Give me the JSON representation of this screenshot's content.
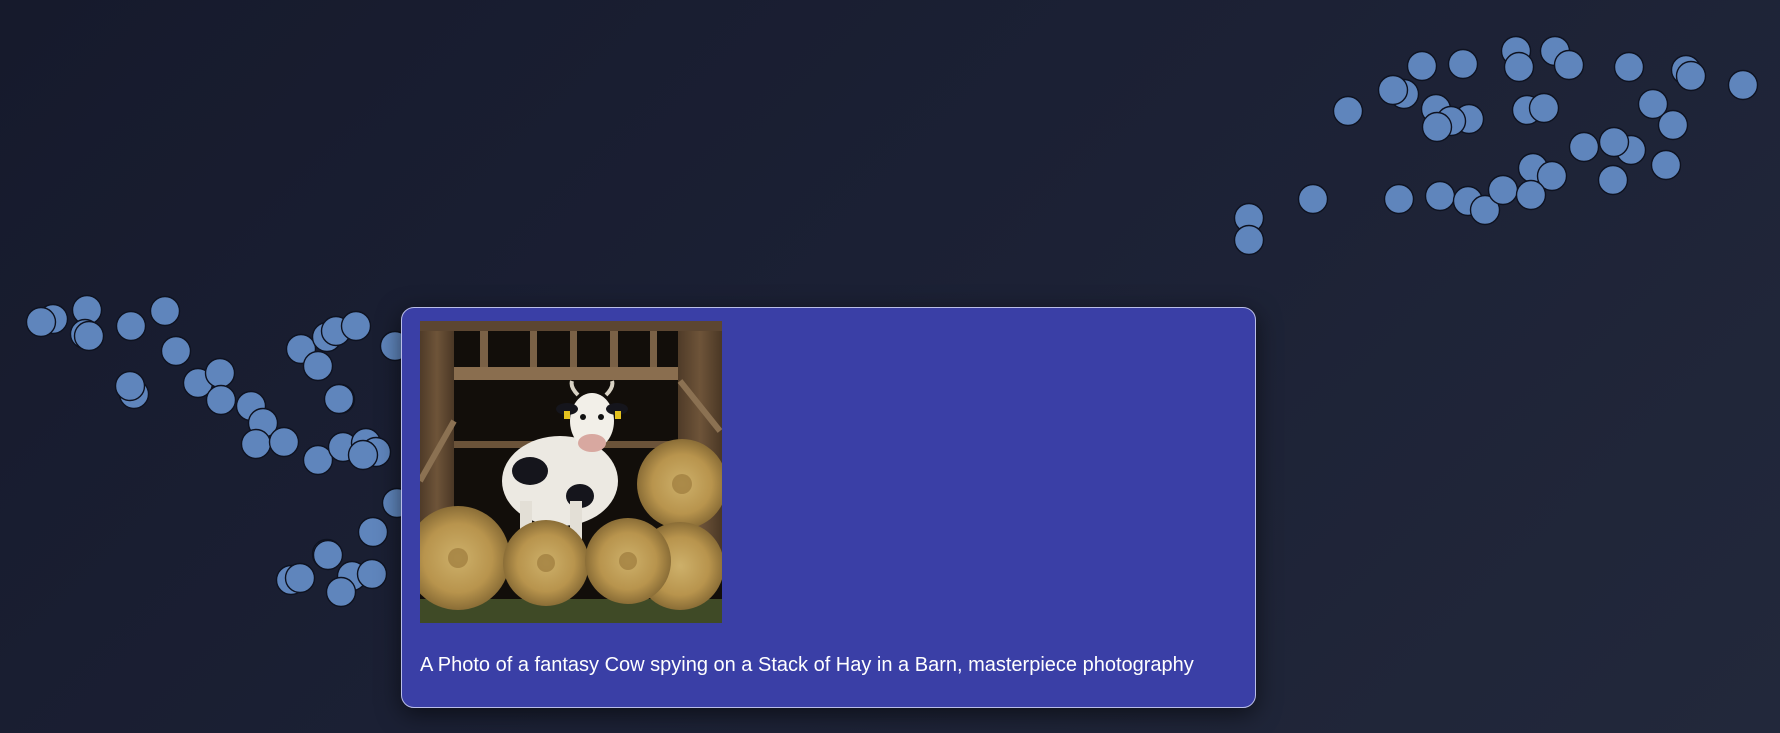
{
  "scatter": {
    "point_color": "#5f85bc",
    "point_count": 92
  },
  "tooltip": {
    "background": "#3a3fa6",
    "image_subject": "cow-in-barn-with-hay-bales",
    "caption": "A Photo of a fantasy Cow spying on a Stack of Hay in a Barn, masterpiece photography"
  }
}
